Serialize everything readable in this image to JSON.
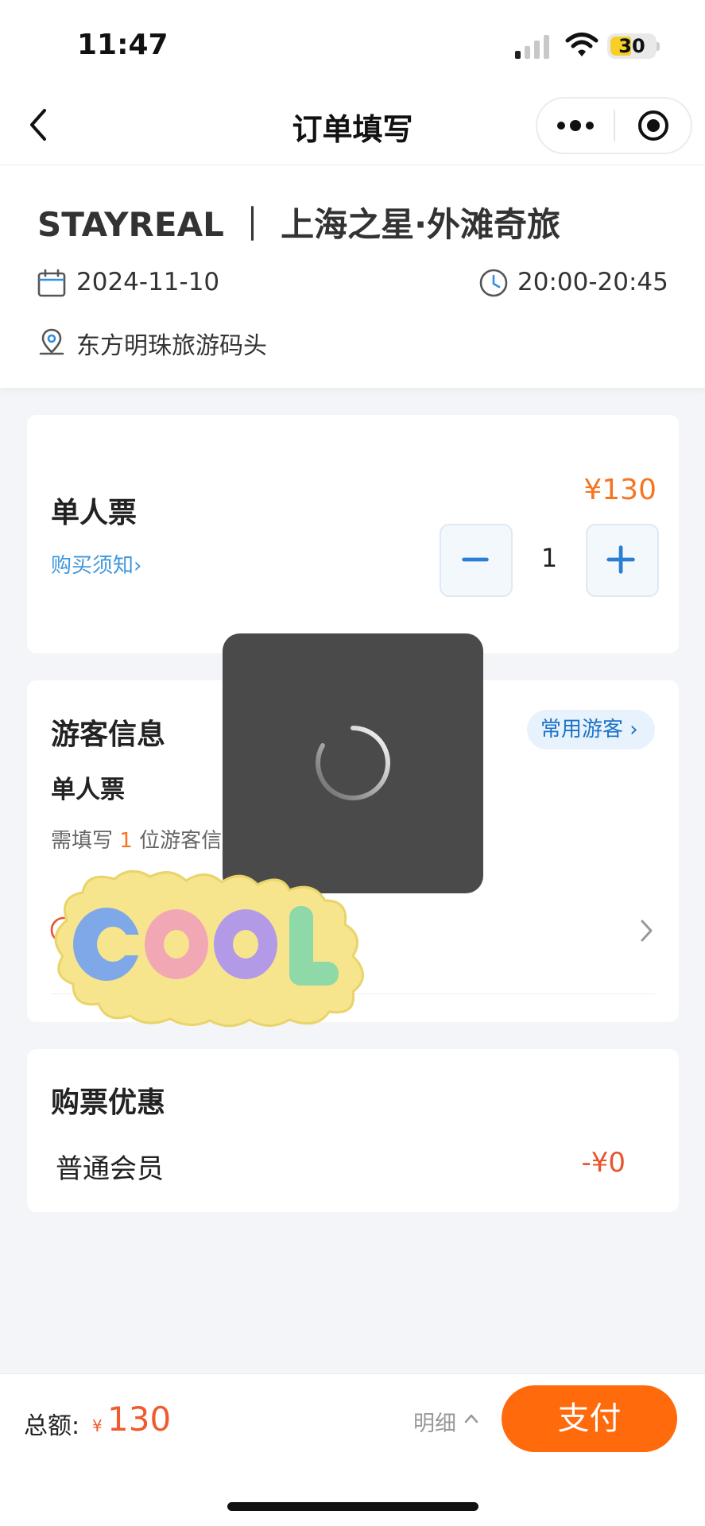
{
  "status_bar": {
    "time": "11:47",
    "battery": "30"
  },
  "nav": {
    "title": "订单填写"
  },
  "event": {
    "title": "STAYREAL ｜ 上海之星·外滩奇旅",
    "date": "2024-11-10",
    "time": "20:00-20:45",
    "location": "东方明珠旅游码头"
  },
  "ticket": {
    "name": "单人票",
    "notice_link": "购买须知",
    "price": "¥130",
    "quantity": "1"
  },
  "visitor": {
    "title": "游客信息",
    "common_button": "常用游客",
    "ticket_type": "单人票",
    "hint_prefix": "需填写",
    "hint_count": "1",
    "hint_suffix": "位游客信"
  },
  "discount": {
    "title": "购票优惠",
    "member_label": "普通会员",
    "member_value": "-¥0"
  },
  "bottom": {
    "total_label": "总额:",
    "total_currency": "¥",
    "total_amount": "130",
    "detail": "明细",
    "pay": "支付"
  },
  "sticker": {
    "text": "COOL"
  },
  "colors": {
    "accent": "#f57520",
    "pay_button": "#ff6a0d",
    "link": "#3f97db",
    "price_red": "#f05a2c"
  }
}
